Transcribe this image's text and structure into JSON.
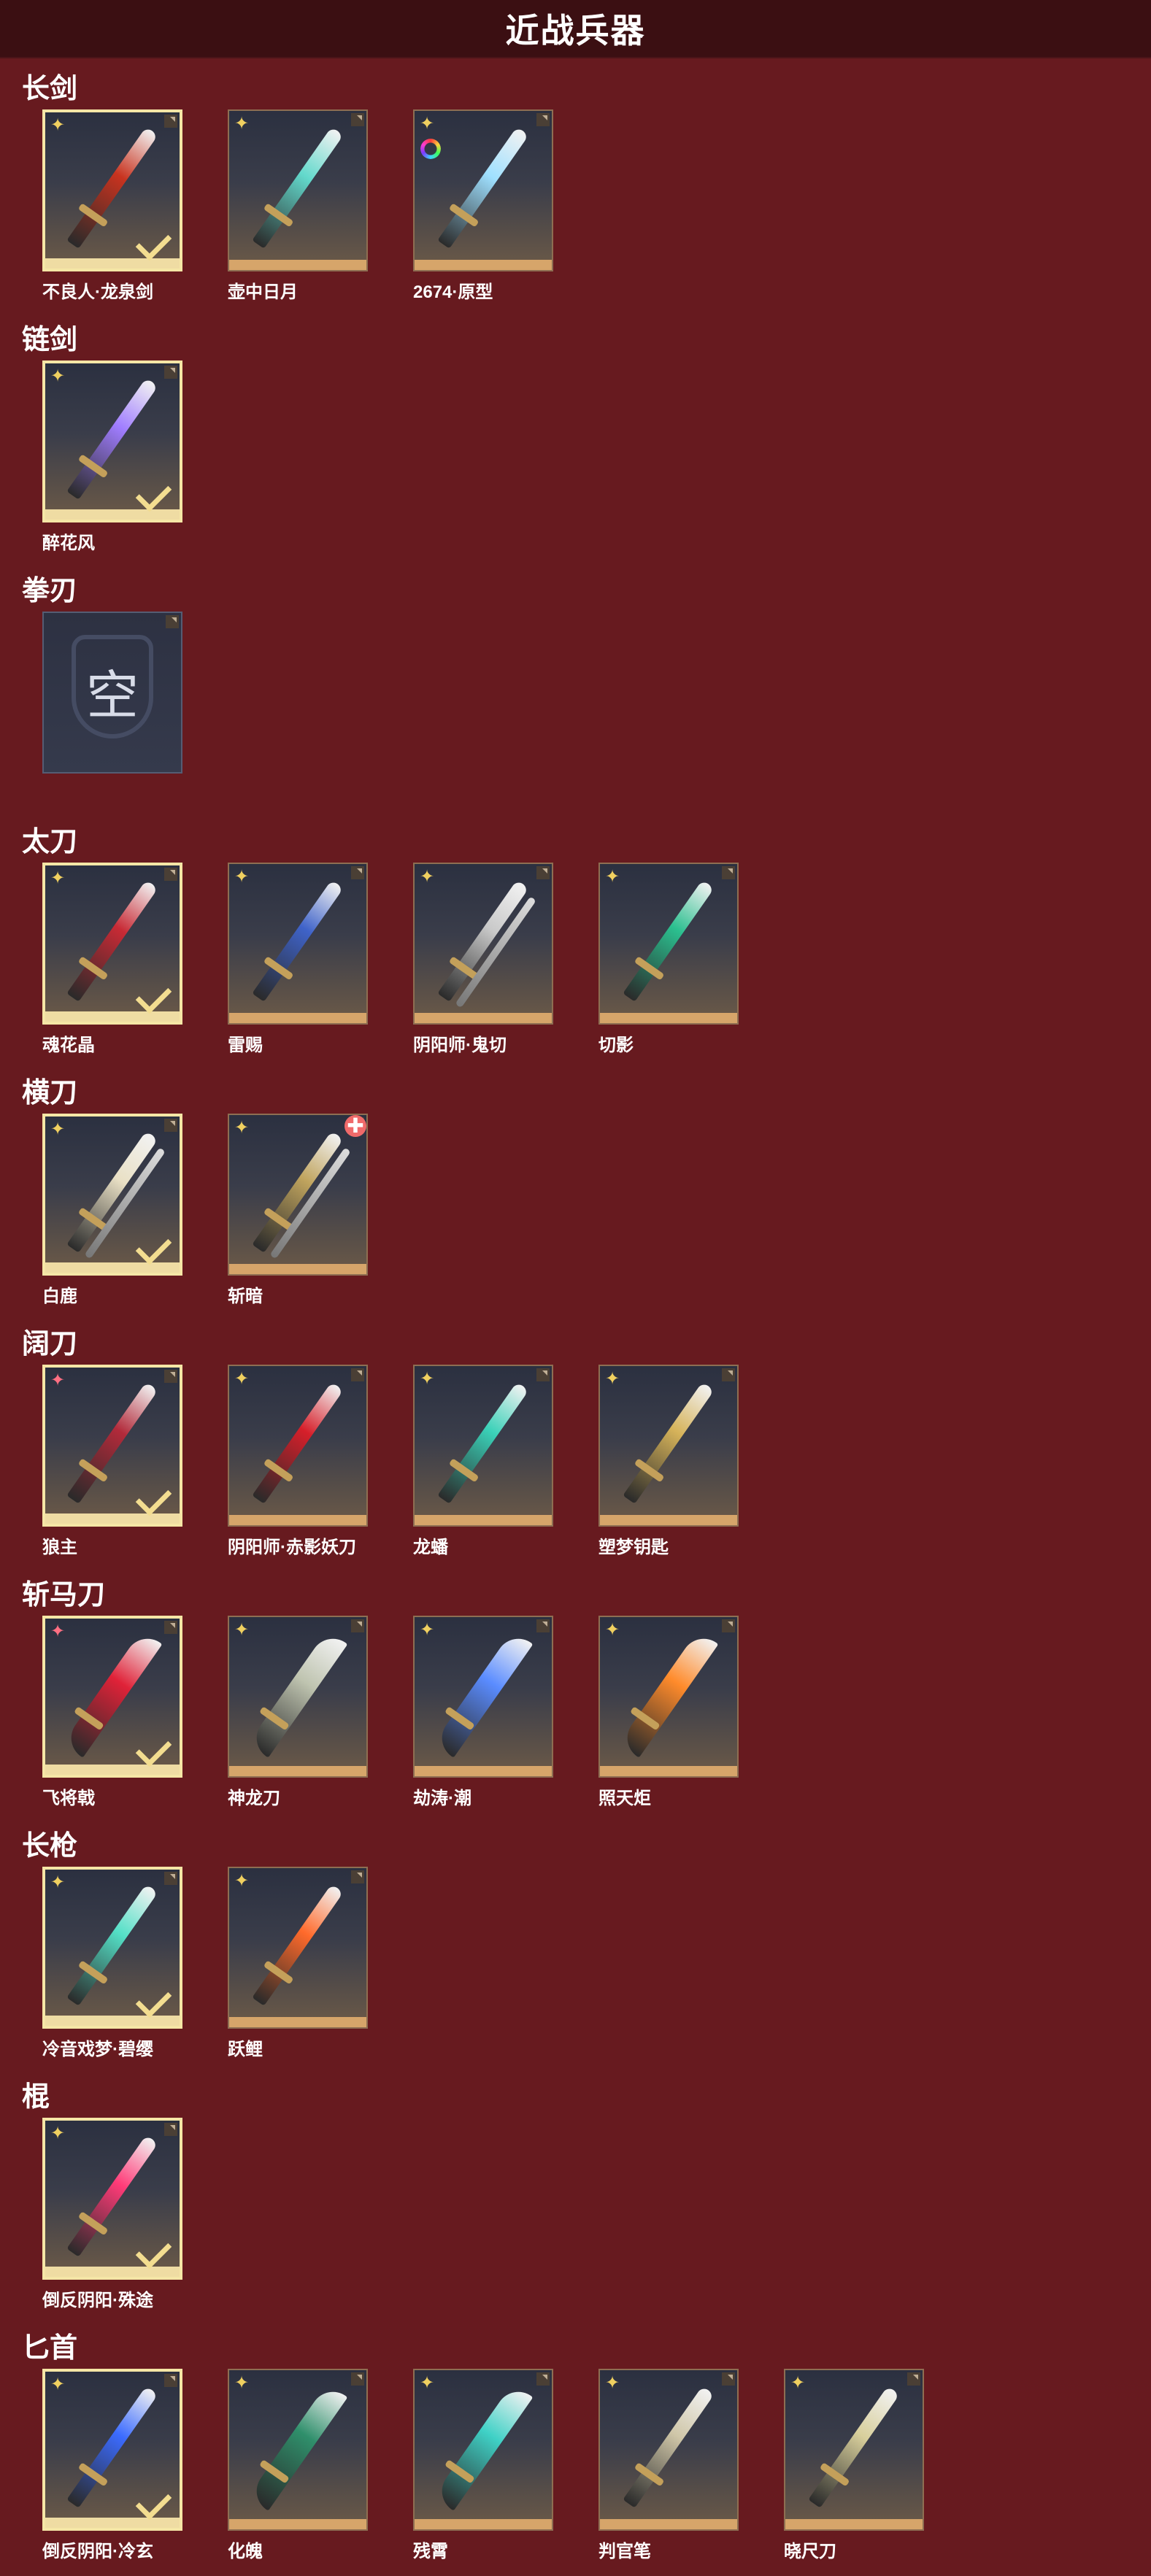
{
  "title": "近战兵器",
  "icons": {
    "star": "star-badge-icon",
    "check": "equipped-check-icon",
    "corner": "corner-tab-icon"
  },
  "colors": {
    "background": "#671a1f",
    "header": "#3b0f12",
    "selected_border": "#f5e6a6"
  },
  "categories": [
    {
      "name": "长剑",
      "items": [
        {
          "label": "不良人·龙泉剑",
          "selected": true,
          "badge": "star",
          "color": "#c8331f",
          "style": "blade"
        },
        {
          "label": "壶中日月",
          "selected": false,
          "badge": "star",
          "color": "#63d9cc",
          "style": "blade"
        },
        {
          "label": "2674·原型",
          "selected": false,
          "badge": "star",
          "extra": "ring",
          "color": "#9fe0ff",
          "style": "blade"
        }
      ]
    },
    {
      "name": "链剑",
      "items": [
        {
          "label": "醉花风",
          "selected": true,
          "badge": "star",
          "color": "#a07dff",
          "style": "blade"
        }
      ]
    },
    {
      "name": "拳刃",
      "items": [
        {
          "label": "",
          "empty": true,
          "empty_text": "空"
        }
      ]
    },
    {
      "name": "太刀",
      "items": [
        {
          "label": "魂花晶",
          "selected": true,
          "badge": "star",
          "color": "#c82a35",
          "style": "blade"
        },
        {
          "label": "雷赐",
          "selected": false,
          "badge": "star",
          "color": "#3f63c9",
          "style": "blade"
        },
        {
          "label": "阴阳师·鬼切",
          "selected": false,
          "badge": "star",
          "color": "#c9c9c9",
          "style": "twin"
        },
        {
          "label": "切影",
          "selected": false,
          "badge": "star",
          "color": "#2bbf8f",
          "style": "blade"
        }
      ]
    },
    {
      "name": "横刀",
      "items": [
        {
          "label": "白鹿",
          "selected": true,
          "badge": "star",
          "color": "#e9e0c5",
          "style": "twin"
        },
        {
          "label": "斩暗",
          "selected": false,
          "badge": "star",
          "extra": "plus",
          "color": "#c0a45e",
          "style": "twin"
        }
      ]
    },
    {
      "name": "阔刀",
      "items": [
        {
          "label": "狼主",
          "selected": true,
          "badge": "red",
          "color": "#b22a3a",
          "style": "blade"
        },
        {
          "label": "阴阳师·赤影妖刀",
          "selected": false,
          "badge": "star",
          "color": "#d61f2a",
          "style": "blade"
        },
        {
          "label": "龙蟠",
          "selected": false,
          "badge": "star",
          "color": "#3ad1b8",
          "style": "blade"
        },
        {
          "label": "塑梦钥匙",
          "selected": false,
          "badge": "star",
          "color": "#d6b35a",
          "style": "blade"
        }
      ]
    },
    {
      "name": "斩马刀",
      "items": [
        {
          "label": "飞将戟",
          "selected": true,
          "badge": "red",
          "color": "#e02238",
          "style": "sickle"
        },
        {
          "label": "神龙刀",
          "selected": false,
          "badge": "star",
          "color": "#bfc4b0",
          "style": "sickle"
        },
        {
          "label": "劫涛·潮",
          "selected": false,
          "badge": "star",
          "color": "#5a8cff",
          "style": "sickle"
        },
        {
          "label": "照天炬",
          "selected": false,
          "badge": "star",
          "color": "#ff8b2b",
          "style": "sickle"
        }
      ]
    },
    {
      "name": "长枪",
      "items": [
        {
          "label": "冷音戏梦·碧缨",
          "selected": true,
          "badge": "star",
          "color": "#54e0c7",
          "style": "blade"
        },
        {
          "label": "跃鲤",
          "selected": false,
          "badge": "star",
          "color": "#ff6a2b",
          "style": "blade"
        }
      ]
    },
    {
      "name": "棍",
      "items": [
        {
          "label": "倒反阴阳·殊途",
          "selected": true,
          "badge": "star",
          "color": "#ff3b78",
          "style": "blade"
        }
      ]
    },
    {
      "name": "匕首",
      "items": [
        {
          "label": "倒反阴阳·冷玄",
          "selected": true,
          "badge": "star",
          "color": "#3b6bff",
          "style": "blade"
        },
        {
          "label": "化魄",
          "selected": false,
          "badge": "star",
          "color": "#2f8f6b",
          "style": "sickle"
        },
        {
          "label": "残霄",
          "selected": false,
          "badge": "star",
          "color": "#3fd1c6",
          "style": "sickle"
        },
        {
          "label": "判官笔",
          "selected": false,
          "badge": "star",
          "color": "#cfc6a8",
          "style": "blade"
        },
        {
          "label": "晓尺刀",
          "selected": false,
          "badge": "star",
          "color": "#d8cf9c",
          "style": "blade"
        }
      ]
    }
  ]
}
